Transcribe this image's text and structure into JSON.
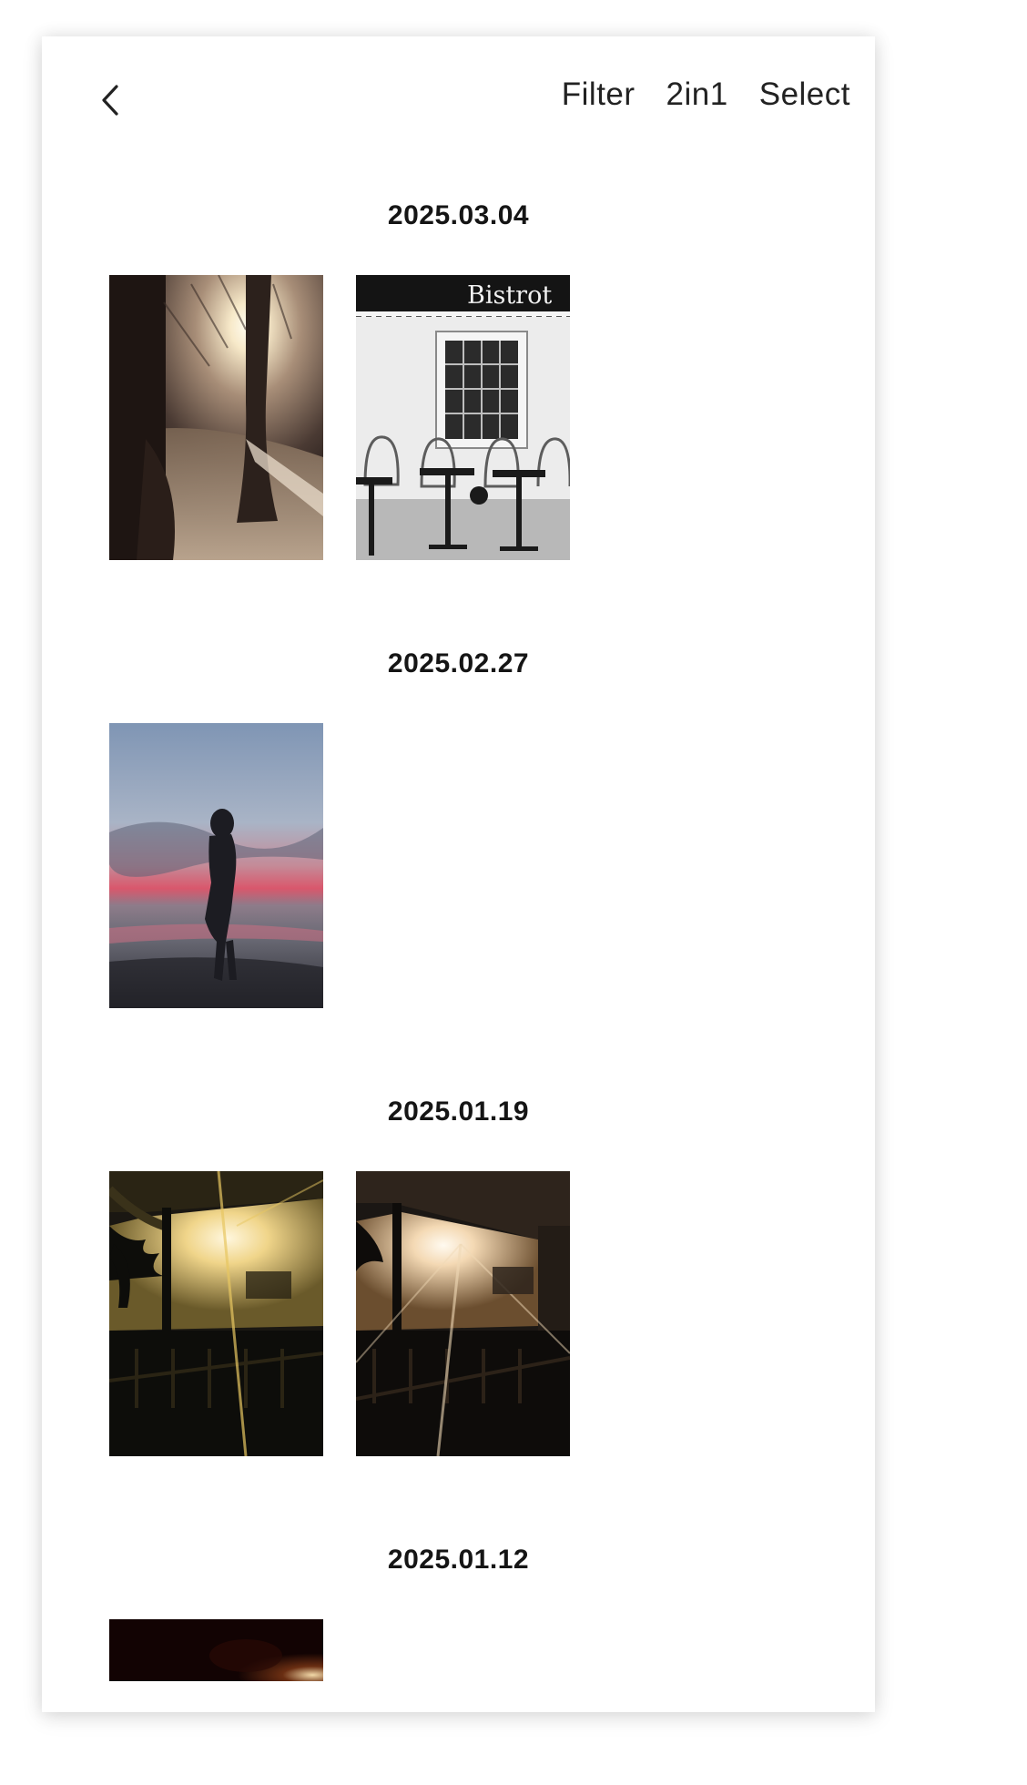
{
  "header": {
    "actions": {
      "filter": "Filter",
      "twoinone": "2in1",
      "select": "Select"
    }
  },
  "sections": [
    {
      "date": "2025.03.04",
      "photos": [
        "sunlit-tree-photo",
        "bistrot-cafe-photo"
      ]
    },
    {
      "date": "2025.02.27",
      "photos": [
        "beach-silhouette-photo"
      ]
    },
    {
      "date": "2025.01.19",
      "photos": [
        "veranda-sunset-photo-1",
        "veranda-sunset-photo-2"
      ]
    },
    {
      "date": "2025.01.12",
      "photos": [
        "dark-evening-photo"
      ]
    }
  ],
  "photo_text": {
    "bistrot_sign": "Bistrot"
  },
  "icons": {
    "back": "chevron-left-icon"
  },
  "colors": {
    "text": "#222222",
    "background": "#ffffff"
  }
}
